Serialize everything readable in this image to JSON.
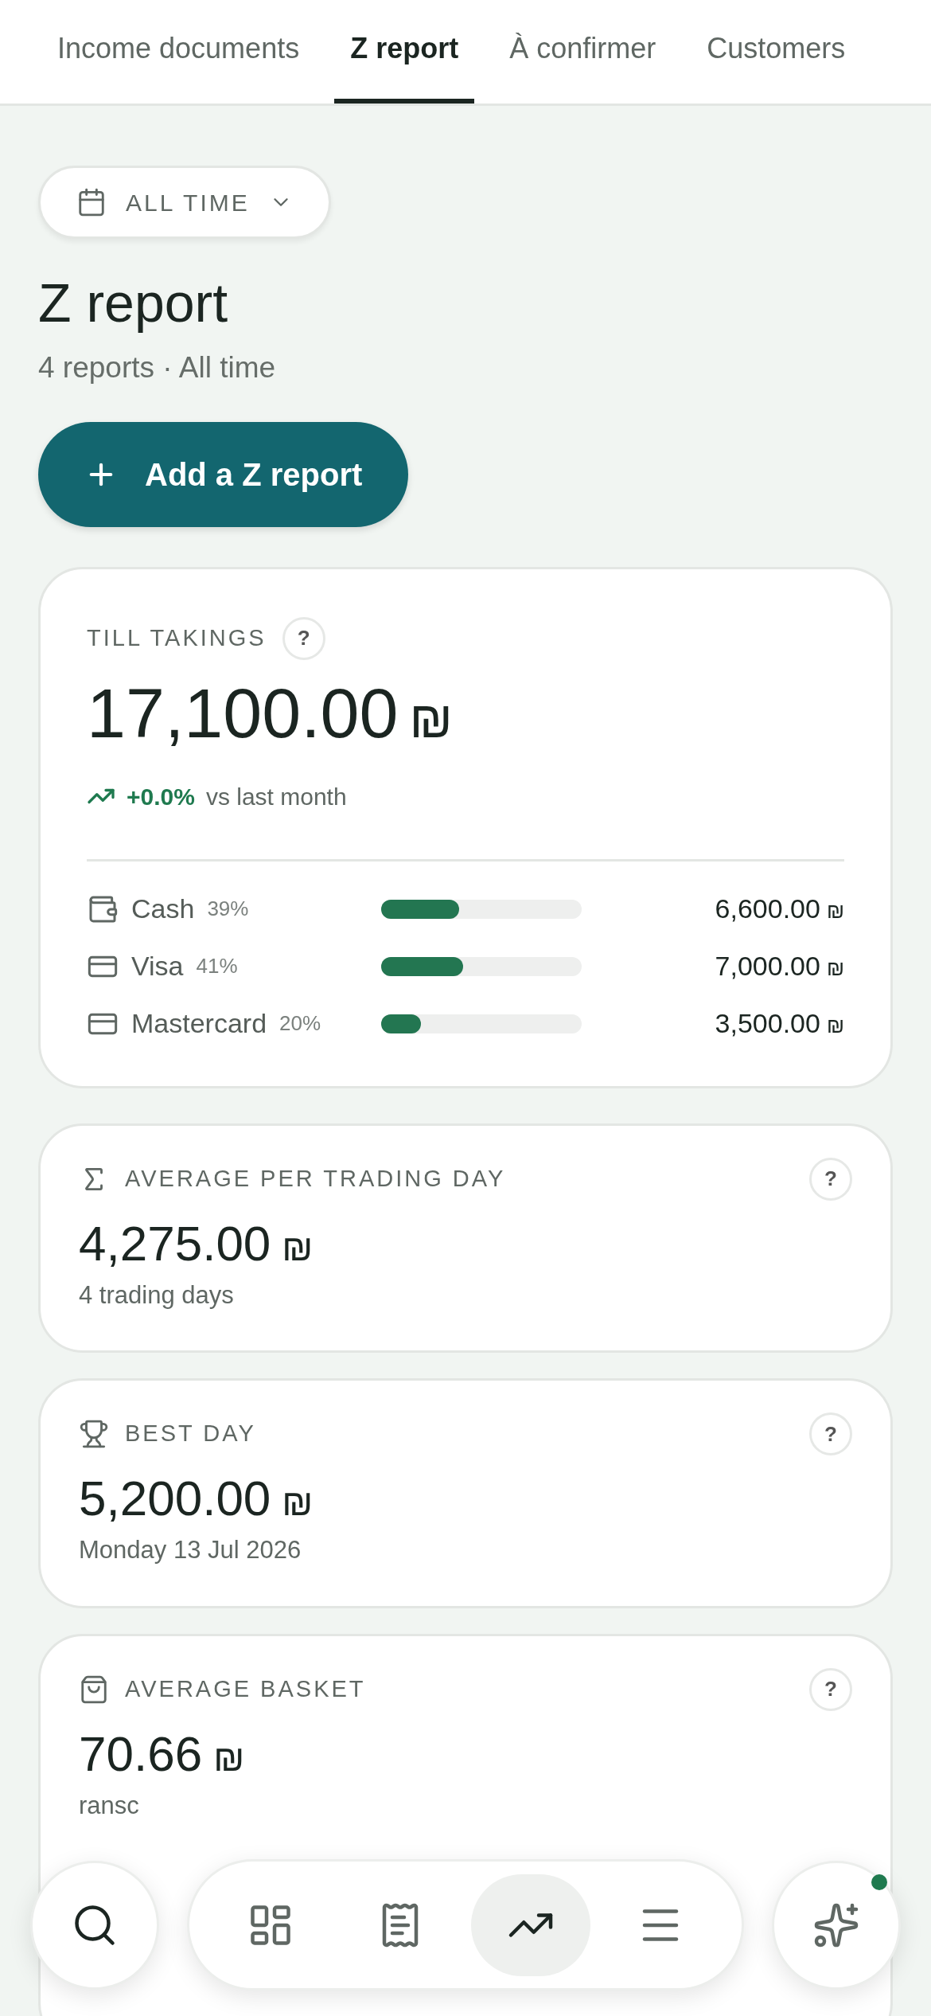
{
  "tabs": [
    {
      "label": "Income documents",
      "selected": false
    },
    {
      "label": "Z report",
      "selected": true
    },
    {
      "label": "À confirmer",
      "selected": false
    },
    {
      "label": "Customers",
      "selected": false
    }
  ],
  "period_filter": {
    "label": "ALL TIME"
  },
  "page": {
    "title": "Z report",
    "subtitle": "4 reports · All time"
  },
  "add_button": {
    "label": "Add a Z report"
  },
  "till_takings": {
    "label": "TILL TAKINGS",
    "help": "?",
    "amount": "17,100.00",
    "currency": "₪",
    "trend": {
      "change": "+0.0%",
      "comparison": "vs last month"
    },
    "methods": [
      {
        "kind": "cash",
        "name": "Cash",
        "share": "39%",
        "level": 0.39,
        "amount": "6,600.00",
        "currency": "₪"
      },
      {
        "kind": "card",
        "name": "Visa",
        "share": "41%",
        "level": 0.41,
        "amount": "7,000.00",
        "currency": "₪"
      },
      {
        "kind": "card",
        "name": "Mastercard",
        "share": "20%",
        "level": 0.2,
        "amount": "3,500.00",
        "currency": "₪"
      }
    ]
  },
  "stat_cards": [
    {
      "kind": "average",
      "label": "AVERAGE PER TRADING DAY",
      "help": "?",
      "amount": "4,275.00",
      "currency": "₪",
      "note": "4 trading days"
    },
    {
      "kind": "best",
      "label": "BEST DAY",
      "help": "?",
      "amount": "5,200.00",
      "currency": "₪",
      "note": "Monday 13 Jul 2026"
    },
    {
      "kind": "basket",
      "label": "AVERAGE BASKET",
      "help": "?",
      "amount": "70.66",
      "currency": "₪",
      "note": "ransc"
    }
  ],
  "bottom_nav": {
    "items": [
      {
        "kind": "search",
        "selected": false
      },
      {
        "kind": "grid",
        "selected": false
      },
      {
        "kind": "receipt",
        "selected": false
      },
      {
        "kind": "trend",
        "selected": true
      },
      {
        "kind": "menu",
        "selected": false
      },
      {
        "kind": "assistant",
        "selected": false,
        "notification": true
      }
    ]
  }
}
